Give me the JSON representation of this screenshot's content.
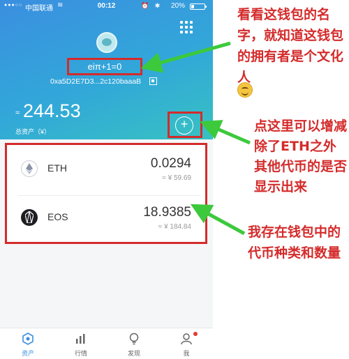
{
  "status_bar": {
    "signal": "●●●○○",
    "carrier": "中国联通",
    "wifi": "≋",
    "time": "00:12",
    "right_icons": "⏰ ✱",
    "battery": "20%"
  },
  "wallet": {
    "name": "eiπ+1=0",
    "address": "0xa5D2E7D3...2c120baaaB",
    "approx_sign": "≈",
    "total_value": "244.53",
    "total_label": "总资产（¥）",
    "add_symbol": "+"
  },
  "assets": [
    {
      "symbol": "ETH",
      "amount": "0.0294",
      "value": "≈ ¥ 59.69",
      "icon": "eth-icon"
    },
    {
      "symbol": "EOS",
      "amount": "18.9385",
      "value": "≈ ¥ 184.84",
      "icon": "eos-icon"
    }
  ],
  "tabs": [
    {
      "label": "资产",
      "icon": "assets-icon",
      "active": true
    },
    {
      "label": "行情",
      "icon": "market-chart-icon",
      "active": false
    },
    {
      "label": "发现",
      "icon": "discover-bulb-icon",
      "active": false
    },
    {
      "label": "我",
      "icon": "profile-icon",
      "active": false
    }
  ],
  "annotations": {
    "note1": "看看这钱包的名字，就知道这钱包的拥有者是个文化人",
    "note2": "点这里可以增减除了ETH之外其他代币的是否显示出来",
    "note3": "我存在钱包中的代币种类和数量",
    "emoji": "smiling-face-icon"
  },
  "colors": {
    "gradient_start": "#3b8fe0",
    "gradient_end": "#37c2c2",
    "annotation_red": "#d42b2b",
    "arrow_green": "#3cc93c",
    "active_tab": "#3b8fe0"
  }
}
